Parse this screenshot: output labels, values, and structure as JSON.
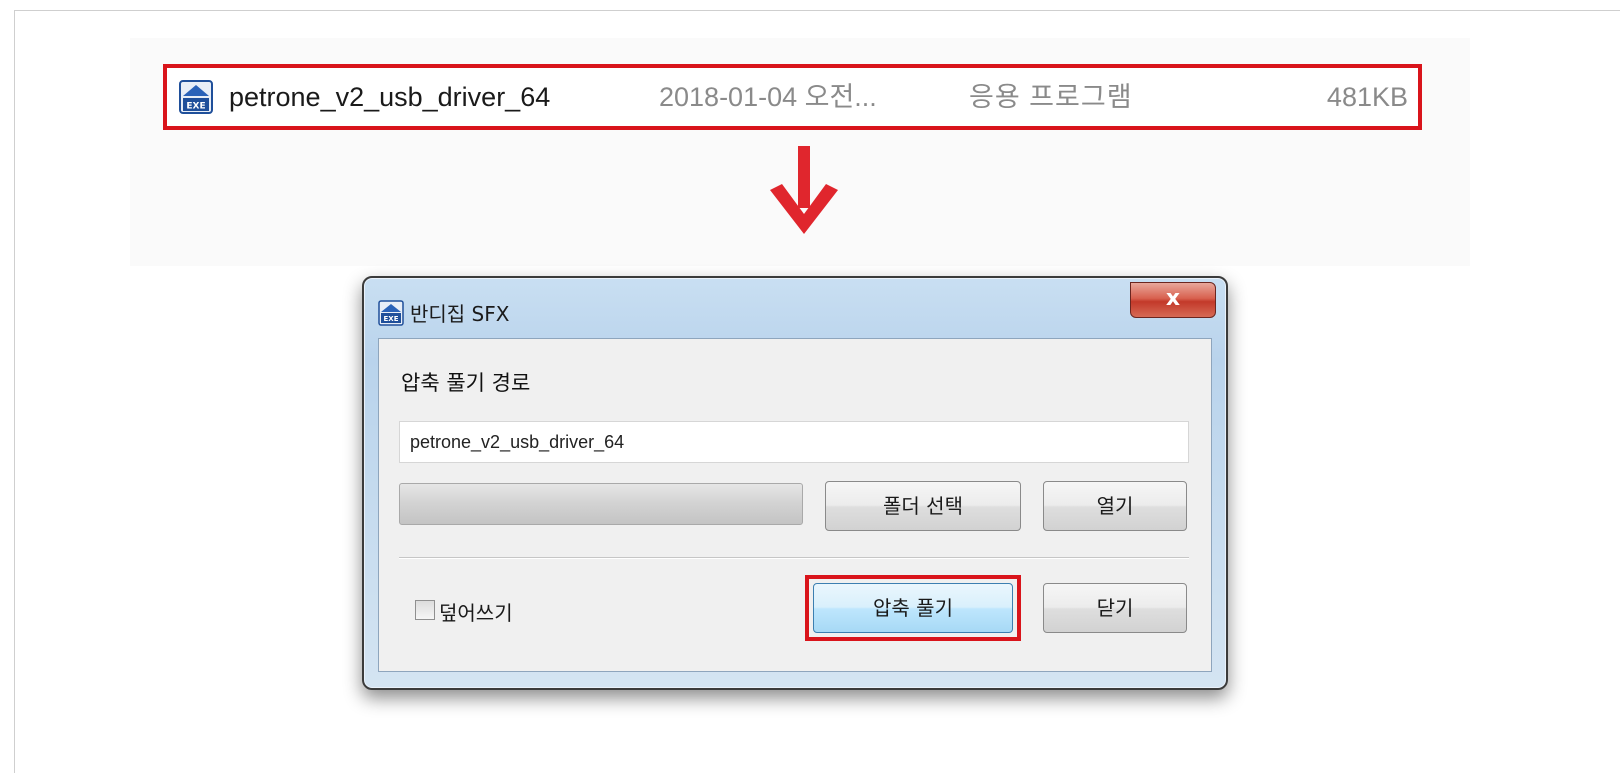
{
  "file_row": {
    "name": "petrone_v2_usb_driver_64",
    "date": "2018-01-04 오전...",
    "type": "응용 프로그램",
    "size": "481KB",
    "icon": "exe-file-icon"
  },
  "dialog": {
    "title": "반디집 SFX",
    "close_label": "x",
    "path_label": "압축 풀기 경로",
    "path_value": "petrone_v2_usb_driver_64",
    "progress": 0,
    "select_folder_label": "폴더 선택",
    "open_label": "열기",
    "overwrite_label": "덮어쓰기",
    "overwrite_checked": false,
    "extract_label": "압축 풀기",
    "close_button_label": "닫기"
  },
  "colors": {
    "highlight": "#d9141b",
    "arrow": "#e0262d"
  }
}
